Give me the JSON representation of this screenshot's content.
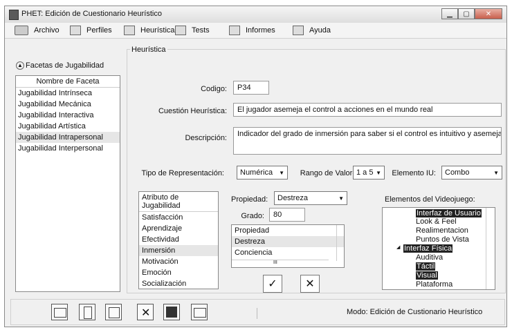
{
  "window": {
    "title": "PHET: Edición de Cuestionario Heurístico"
  },
  "menu": [
    {
      "label": "Archivo"
    },
    {
      "label": "Perfiles"
    },
    {
      "label": "Heurísticas"
    },
    {
      "label": "Tests"
    },
    {
      "label": "Informes"
    },
    {
      "label": "Ayuda"
    }
  ],
  "facets": {
    "title": "Facetas de Jugabilidad",
    "header": "Nombre de Faceta",
    "items": [
      "Jugabilidad Intrínseca",
      "Jugabilidad Mecánica",
      "Jugabilidad Interactiva",
      "Jugabilidad Artística",
      "Jugabilidad Intrapersonal",
      "Jugabilidad Interpersonal"
    ],
    "selected_index": 4
  },
  "heuristic": {
    "group_label": "Heurística",
    "codigo_label": "Codigo:",
    "codigo_value": "P34",
    "cuestion_label": "Cuestión Heurística:",
    "cuestion_value": "El jugador asemeja el control a acciones en el mundo real",
    "descripcion_label": "Descripción:",
    "descripcion_value": "Indicador del grado de inmersión para saber si el control es intuitivo y asemejable al mu",
    "tipo_label": "Tipo de Representación:",
    "tipo_value": "Numérica",
    "rango_label": "Rango de Valores:",
    "rango_value": "1 a 5",
    "elemento_label": "Elemento IU:",
    "elemento_value": "Combo"
  },
  "attributes": {
    "header": "Atributo de Jugabilidad",
    "items": [
      "Satisfacción",
      "Aprendizaje",
      "Efectividad",
      "Inmersión",
      "Motivación",
      "Emoción",
      "Socialización"
    ],
    "selected_index": 3
  },
  "property": {
    "label": "Propiedad:",
    "value": "Destreza",
    "grado_label": "Grado:",
    "grado_value": "80",
    "list_header": "Propiedad",
    "list_items": [
      "Destreza",
      "Conciencia"
    ],
    "scroll_glyph": "III"
  },
  "videogame": {
    "label": "Elementos del Videojuego:",
    "items": [
      {
        "text": "Interfaz de Usuario",
        "hl": true
      },
      {
        "text": "Look & Feel",
        "hl": false
      },
      {
        "text": "Realimentacion",
        "hl": false
      },
      {
        "text": "Puntos de Vista",
        "hl": false
      },
      {
        "text": "Interfaz Física",
        "hl": true
      },
      {
        "text": "Auditiva",
        "hl": false
      },
      {
        "text": "Táctil",
        "hl": true
      },
      {
        "text": "Visual",
        "hl": true
      },
      {
        "text": "Plataforma",
        "hl": false
      }
    ]
  },
  "status": {
    "text": "Modo: Edición de Custionario Heurístico"
  }
}
